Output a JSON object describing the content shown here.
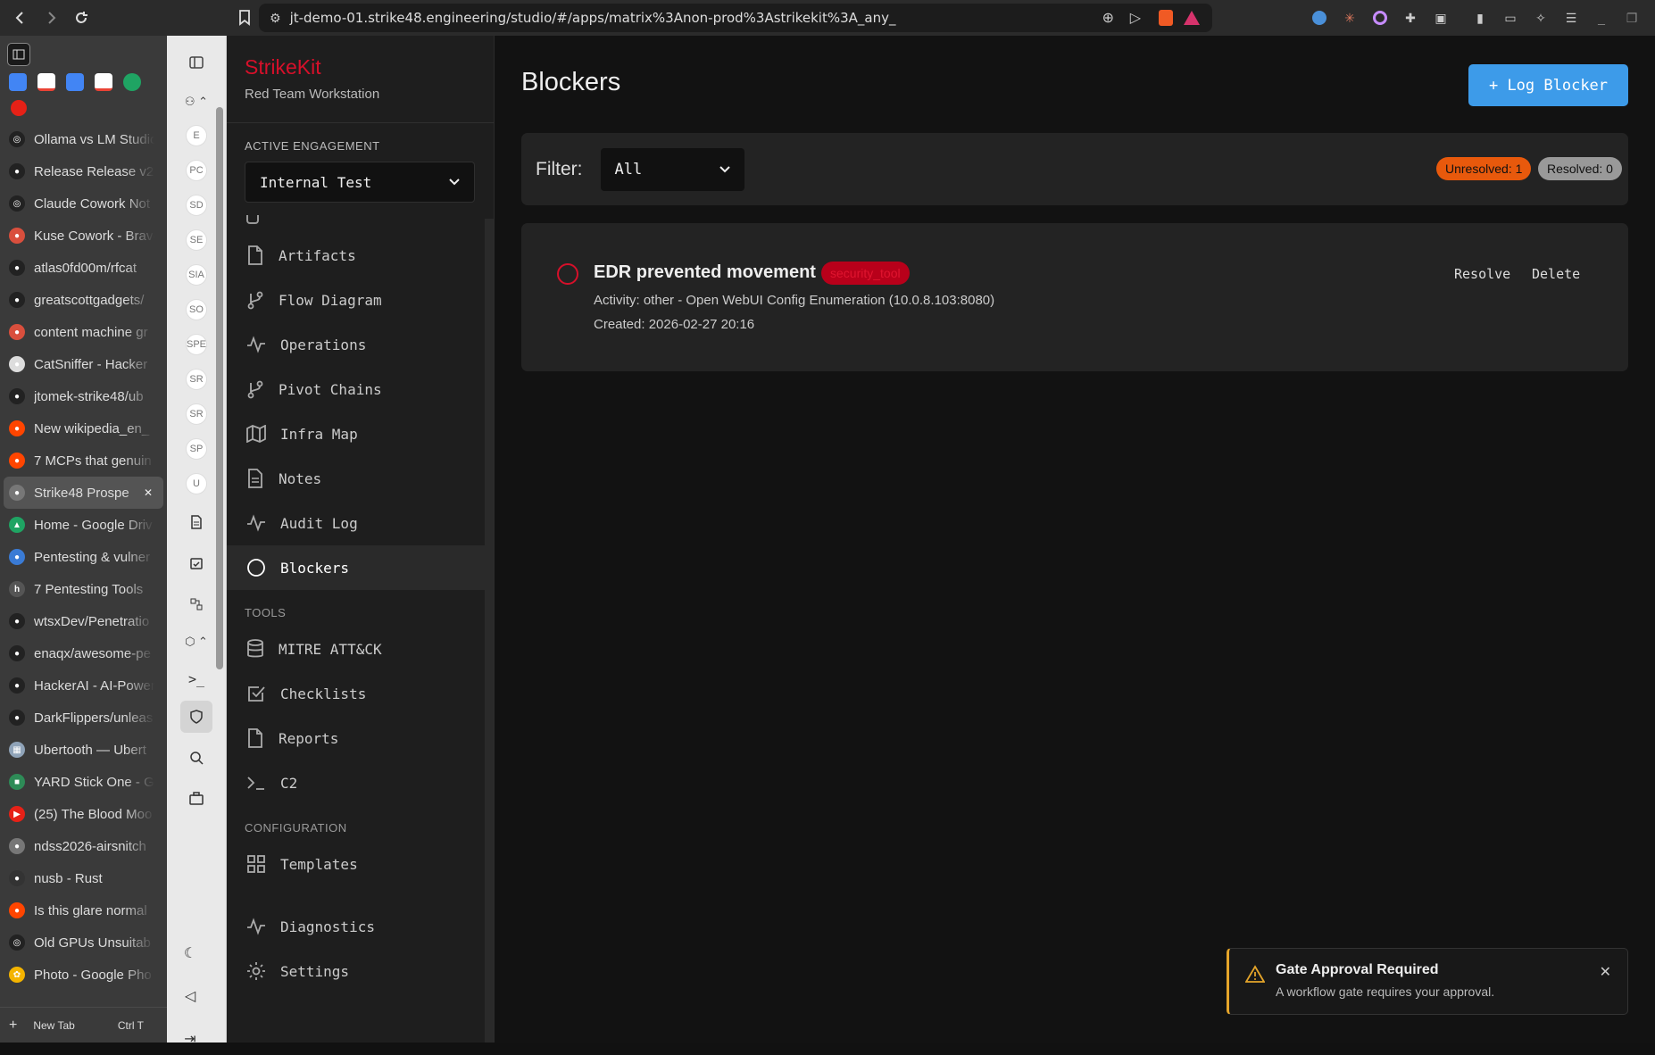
{
  "browser": {
    "url": "jt-demo-01.strike48.engineering/studio/#/apps/matrix%3Anon-prod%3Astrikekit%3A_any_",
    "tabs": [
      {
        "label": "Ollama vs LM Studio",
        "fav": "#222",
        "glyph": "◎"
      },
      {
        "label": "Release Release v2",
        "fav": "#222",
        "glyph": "●"
      },
      {
        "label": "Claude Cowork Not",
        "fav": "#222",
        "glyph": "◎"
      },
      {
        "label": "Kuse Cowork - Brave",
        "fav": "#d94f3d",
        "glyph": "●"
      },
      {
        "label": "atlas0fd00m/rfcat",
        "fav": "#222",
        "glyph": "●"
      },
      {
        "label": "greatscottgadgets/",
        "fav": "#222",
        "glyph": "●"
      },
      {
        "label": "content machine gr",
        "fav": "#d94f3d",
        "glyph": "●"
      },
      {
        "label": "CatSniffer - Hacker",
        "fav": "#ddd",
        "glyph": "●"
      },
      {
        "label": "jtomek-strike48/ub",
        "fav": "#222",
        "glyph": "●"
      },
      {
        "label": "New wikipedia_en_",
        "fav": "#ff4500",
        "glyph": "●"
      },
      {
        "label": "7 MCPs that genuin",
        "fav": "#ff4500",
        "glyph": "●"
      },
      {
        "label": "Strike48 Prospe",
        "fav": "#777",
        "glyph": "●",
        "active": true
      },
      {
        "label": "Home - Google Driv",
        "fav": "#1fa463",
        "glyph": "▲"
      },
      {
        "label": "Pentesting & vulner",
        "fav": "#3a7bd5",
        "glyph": "●"
      },
      {
        "label": "7 Pentesting Tools",
        "fav": "#555",
        "glyph": "h"
      },
      {
        "label": "wtsxDev/Penetratio",
        "fav": "#222",
        "glyph": "●"
      },
      {
        "label": "enaqx/awesome-pe",
        "fav": "#222",
        "glyph": "●"
      },
      {
        "label": "HackerAI - AI-Power",
        "fav": "#222",
        "glyph": "●"
      },
      {
        "label": "DarkFlippers/unleas",
        "fav": "#222",
        "glyph": "●"
      },
      {
        "label": "Ubertooth — Ubert",
        "fav": "#8fa3b8",
        "glyph": "▦"
      },
      {
        "label": "YARD Stick One - Gr",
        "fav": "#2e8b57",
        "glyph": "■"
      },
      {
        "label": "(25) The Blood Moo",
        "fav": "#e62117",
        "glyph": "▶"
      },
      {
        "label": "ndss2026-airsnitch",
        "fav": "#777",
        "glyph": "●"
      },
      {
        "label": "nusb - Rust",
        "fav": "#333",
        "glyph": "●"
      },
      {
        "label": "Is this glare normal",
        "fav": "#ff4500",
        "glyph": "●"
      },
      {
        "label": "Old GPUs Unsuitab",
        "fav": "#222",
        "glyph": "◎"
      },
      {
        "label": "Photo - Google Pho",
        "fav": "#f4b400",
        "glyph": "✿"
      }
    ],
    "new_tab": "New Tab",
    "new_tab_shortcut": "Ctrl T"
  },
  "rail": {
    "avatars": [
      "E",
      "PC",
      "SD",
      "SE",
      "SIA",
      "SO",
      "SPE",
      "SR",
      "SR",
      "SP",
      "U"
    ]
  },
  "app": {
    "name": "StrikeKit",
    "subtitle": "Red Team Workstation",
    "engagement_heading": "ACTIVE ENGAGEMENT",
    "engagement_value": "Internal Test",
    "nav": {
      "artifacts": "Artifacts",
      "flow": "Flow Diagram",
      "operations": "Operations",
      "pivot": "Pivot Chains",
      "infra": "Infra Map",
      "notes": "Notes",
      "audit": "Audit Log",
      "blockers": "Blockers",
      "tools_heading": "TOOLS",
      "mitre": "MITRE ATT&CK",
      "checklists": "Checklists",
      "reports": "Reports",
      "c2": "C2",
      "config_heading": "CONFIGURATION",
      "templates": "Templates",
      "diagnostics": "Diagnostics",
      "settings": "Settings"
    }
  },
  "main": {
    "title": "Blockers",
    "log_button": "+ Log Blocker",
    "filter_label": "Filter:",
    "filter_value": "All",
    "unresolved": "Unresolved: 1",
    "resolved": "Resolved: 0",
    "blocker": {
      "title": "EDR prevented movement",
      "tag": "security_tool",
      "activity": "Activity: other - Open WebUI Config Enumeration (10.0.8.103:8080)",
      "created": "Created: 2026-02-27 20:16",
      "resolve": "Resolve",
      "delete": "Delete"
    }
  },
  "toast": {
    "title": "Gate Approval Required",
    "message": "A workflow gate requires your approval."
  }
}
